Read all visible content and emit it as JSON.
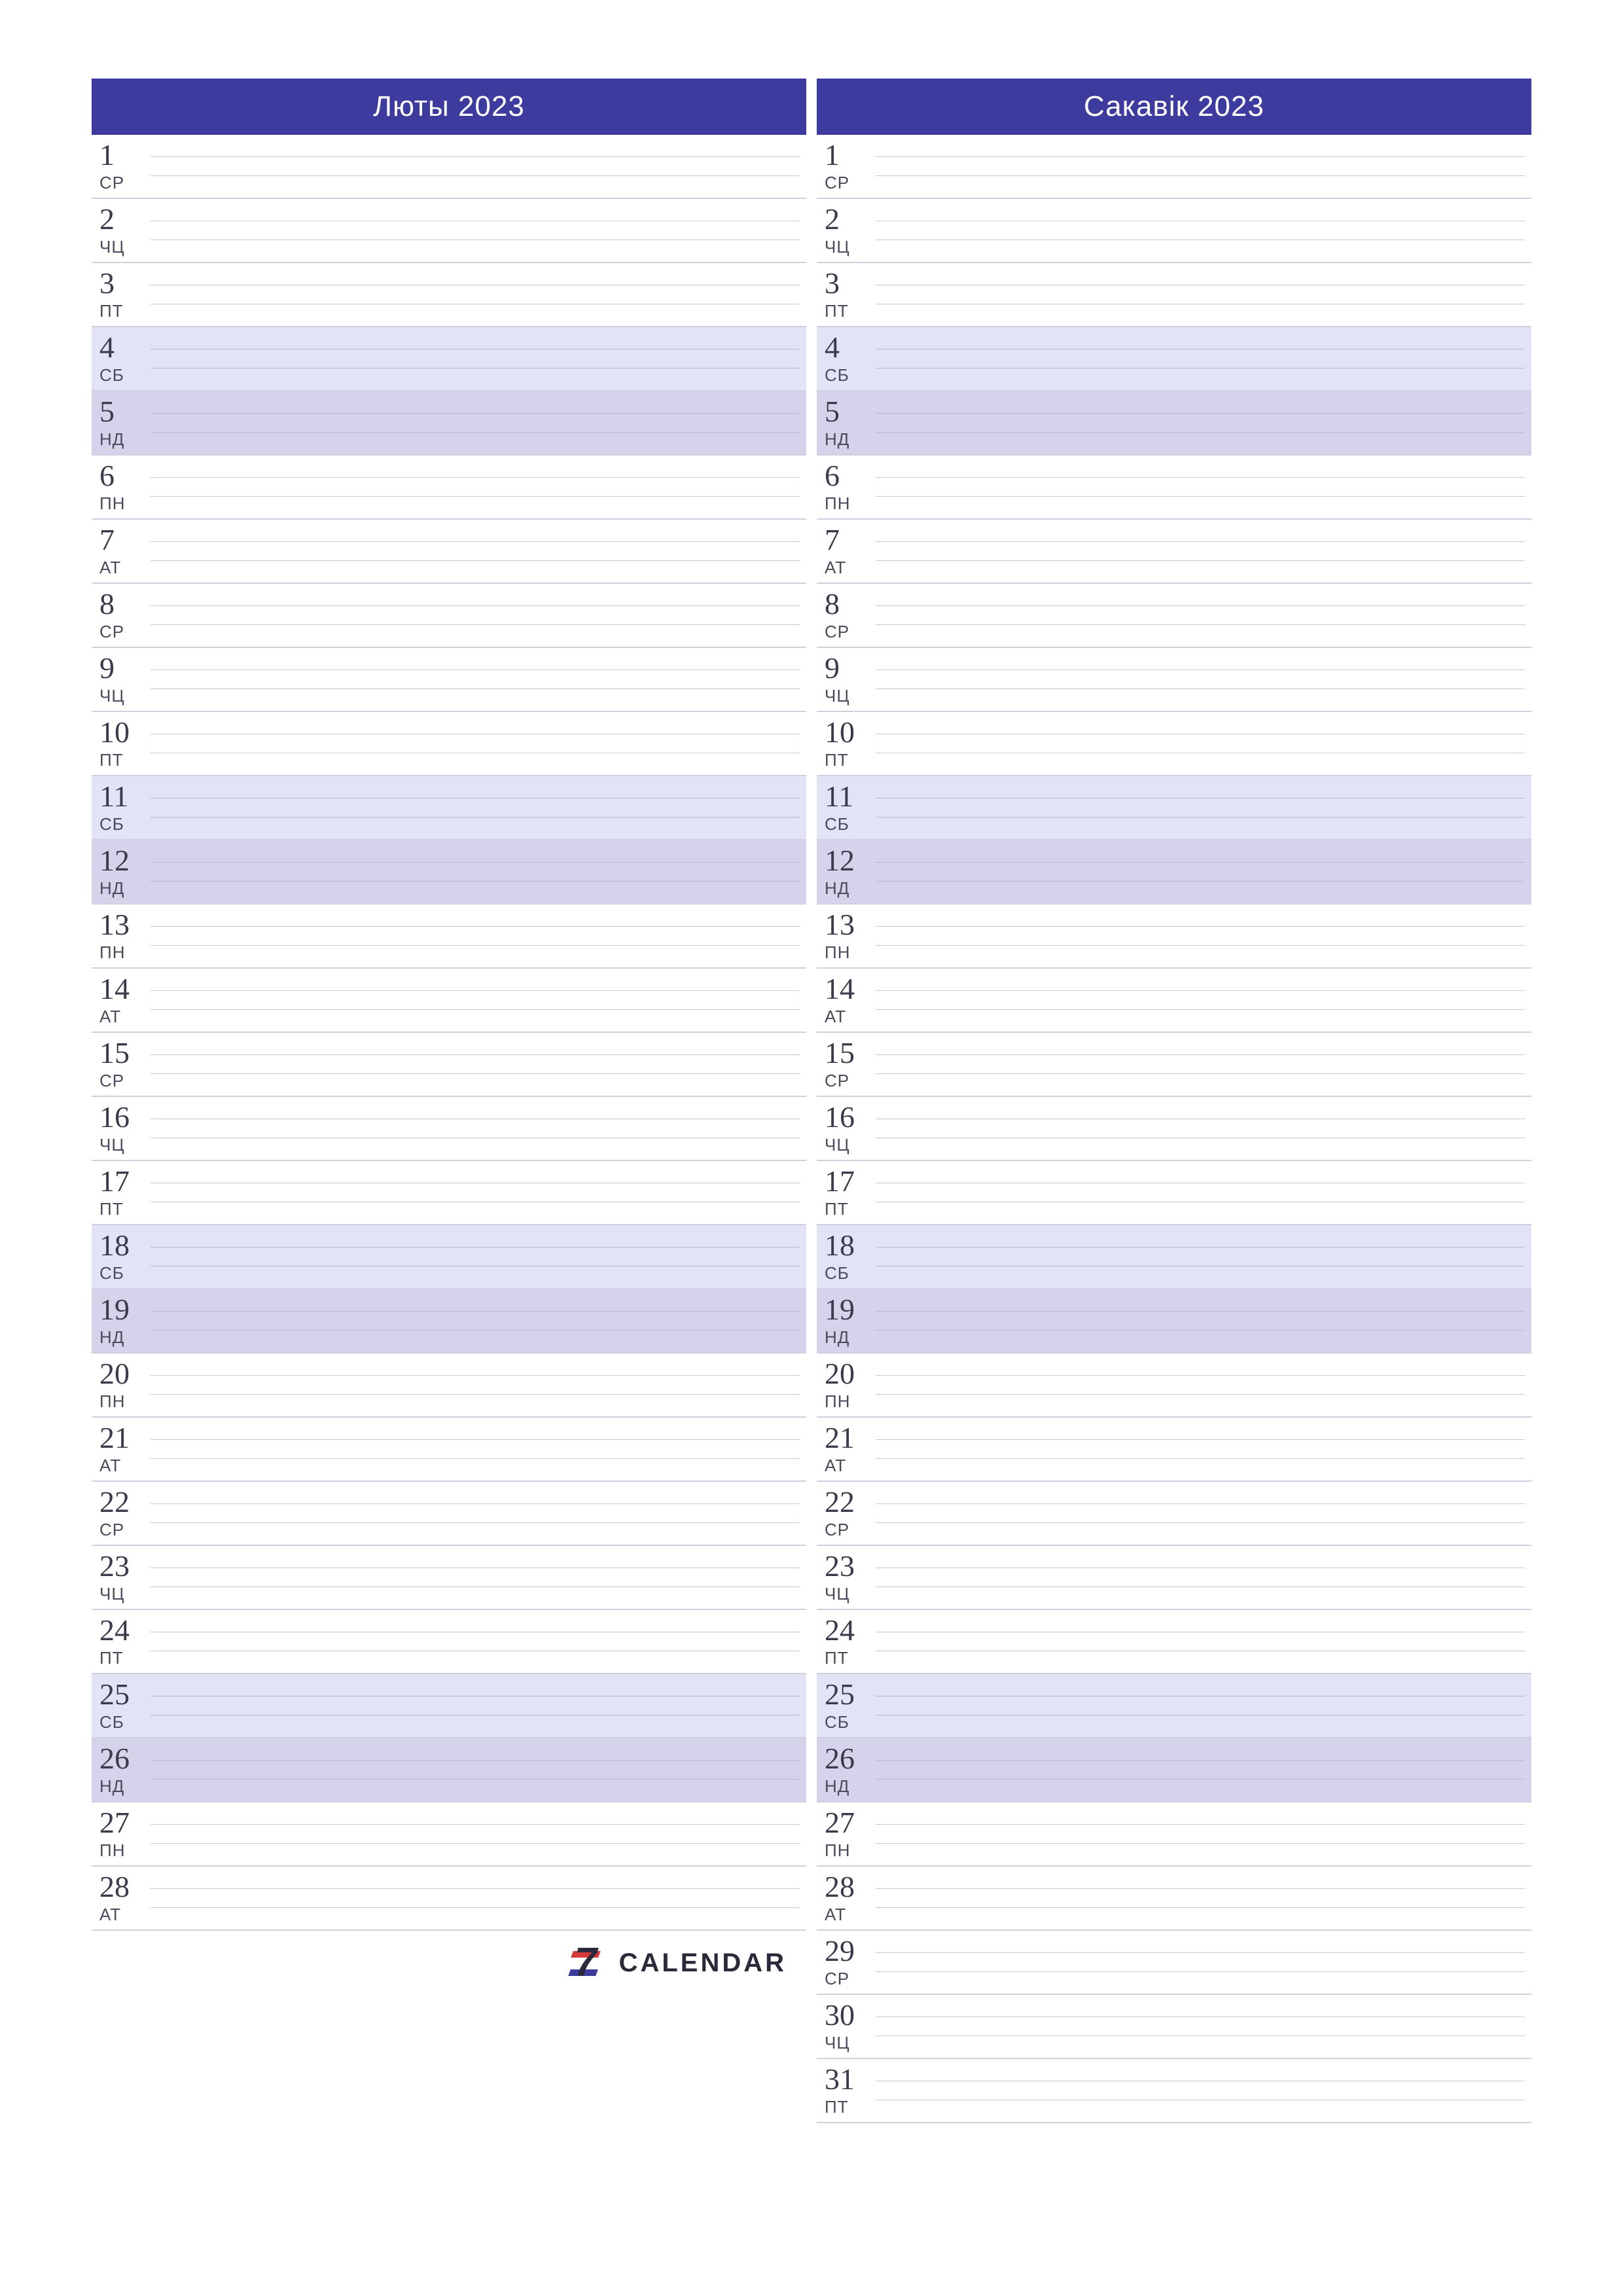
{
  "logo": {
    "text": "CALENDAR"
  },
  "weekday_labels": {
    "mon": "ПН",
    "tue": "АТ",
    "wed": "СР",
    "thu": "ЧЦ",
    "fri": "ПТ",
    "sat": "СБ",
    "sun": "НД"
  },
  "columns": [
    {
      "title": "Люты 2023",
      "show_logo_after": true,
      "days": [
        {
          "n": "1",
          "w": "СР",
          "type": "weekday"
        },
        {
          "n": "2",
          "w": "ЧЦ",
          "type": "weekday"
        },
        {
          "n": "3",
          "w": "ПТ",
          "type": "weekday"
        },
        {
          "n": "4",
          "w": "СБ",
          "type": "saturday"
        },
        {
          "n": "5",
          "w": "НД",
          "type": "sunday"
        },
        {
          "n": "6",
          "w": "ПН",
          "type": "weekday"
        },
        {
          "n": "7",
          "w": "АТ",
          "type": "weekday"
        },
        {
          "n": "8",
          "w": "СР",
          "type": "weekday"
        },
        {
          "n": "9",
          "w": "ЧЦ",
          "type": "weekday"
        },
        {
          "n": "10",
          "w": "ПТ",
          "type": "weekday"
        },
        {
          "n": "11",
          "w": "СБ",
          "type": "saturday"
        },
        {
          "n": "12",
          "w": "НД",
          "type": "sunday"
        },
        {
          "n": "13",
          "w": "ПН",
          "type": "weekday"
        },
        {
          "n": "14",
          "w": "АТ",
          "type": "weekday"
        },
        {
          "n": "15",
          "w": "СР",
          "type": "weekday"
        },
        {
          "n": "16",
          "w": "ЧЦ",
          "type": "weekday"
        },
        {
          "n": "17",
          "w": "ПТ",
          "type": "weekday"
        },
        {
          "n": "18",
          "w": "СБ",
          "type": "saturday"
        },
        {
          "n": "19",
          "w": "НД",
          "type": "sunday"
        },
        {
          "n": "20",
          "w": "ПН",
          "type": "weekday"
        },
        {
          "n": "21",
          "w": "АТ",
          "type": "weekday"
        },
        {
          "n": "22",
          "w": "СР",
          "type": "weekday"
        },
        {
          "n": "23",
          "w": "ЧЦ",
          "type": "weekday"
        },
        {
          "n": "24",
          "w": "ПТ",
          "type": "weekday"
        },
        {
          "n": "25",
          "w": "СБ",
          "type": "saturday"
        },
        {
          "n": "26",
          "w": "НД",
          "type": "sunday"
        },
        {
          "n": "27",
          "w": "ПН",
          "type": "weekday"
        },
        {
          "n": "28",
          "w": "АТ",
          "type": "weekday"
        }
      ]
    },
    {
      "title": "Сакавік 2023",
      "show_logo_after": false,
      "days": [
        {
          "n": "1",
          "w": "СР",
          "type": "weekday"
        },
        {
          "n": "2",
          "w": "ЧЦ",
          "type": "weekday"
        },
        {
          "n": "3",
          "w": "ПТ",
          "type": "weekday"
        },
        {
          "n": "4",
          "w": "СБ",
          "type": "saturday"
        },
        {
          "n": "5",
          "w": "НД",
          "type": "sunday"
        },
        {
          "n": "6",
          "w": "ПН",
          "type": "weekday"
        },
        {
          "n": "7",
          "w": "АТ",
          "type": "weekday"
        },
        {
          "n": "8",
          "w": "СР",
          "type": "weekday"
        },
        {
          "n": "9",
          "w": "ЧЦ",
          "type": "weekday"
        },
        {
          "n": "10",
          "w": "ПТ",
          "type": "weekday"
        },
        {
          "n": "11",
          "w": "СБ",
          "type": "saturday"
        },
        {
          "n": "12",
          "w": "НД",
          "type": "sunday"
        },
        {
          "n": "13",
          "w": "ПН",
          "type": "weekday"
        },
        {
          "n": "14",
          "w": "АТ",
          "type": "weekday"
        },
        {
          "n": "15",
          "w": "СР",
          "type": "weekday"
        },
        {
          "n": "16",
          "w": "ЧЦ",
          "type": "weekday"
        },
        {
          "n": "17",
          "w": "ПТ",
          "type": "weekday"
        },
        {
          "n": "18",
          "w": "СБ",
          "type": "saturday"
        },
        {
          "n": "19",
          "w": "НД",
          "type": "sunday"
        },
        {
          "n": "20",
          "w": "ПН",
          "type": "weekday"
        },
        {
          "n": "21",
          "w": "АТ",
          "type": "weekday"
        },
        {
          "n": "22",
          "w": "СР",
          "type": "weekday"
        },
        {
          "n": "23",
          "w": "ЧЦ",
          "type": "weekday"
        },
        {
          "n": "24",
          "w": "ПТ",
          "type": "weekday"
        },
        {
          "n": "25",
          "w": "СБ",
          "type": "saturday"
        },
        {
          "n": "26",
          "w": "НД",
          "type": "sunday"
        },
        {
          "n": "27",
          "w": "ПН",
          "type": "weekday"
        },
        {
          "n": "28",
          "w": "АТ",
          "type": "weekday"
        },
        {
          "n": "29",
          "w": "СР",
          "type": "weekday"
        },
        {
          "n": "30",
          "w": "ЧЦ",
          "type": "weekday"
        },
        {
          "n": "31",
          "w": "ПТ",
          "type": "weekday"
        }
      ]
    }
  ]
}
